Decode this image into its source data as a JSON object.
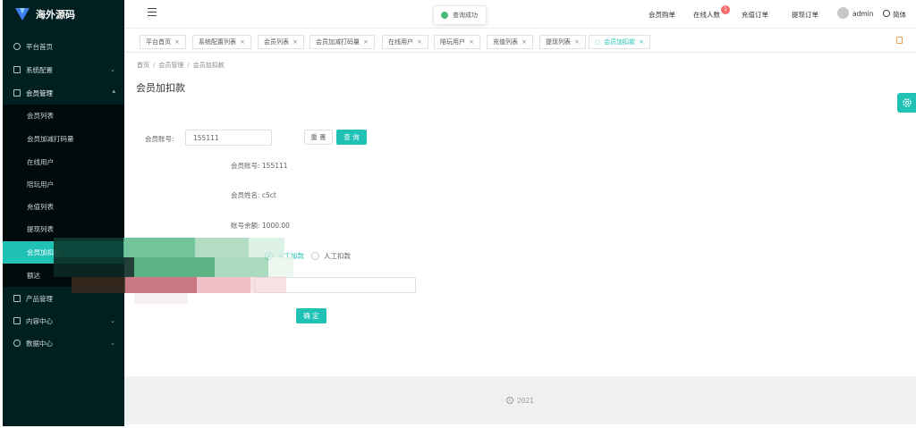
{
  "app": {
    "logo_text": "海外源码"
  },
  "sidebar": {
    "items": [
      {
        "label": "平台首页",
        "icon": "clock-icon"
      },
      {
        "label": "系统配置",
        "icon": "edit-icon"
      },
      {
        "label": "会员管理",
        "icon": "grid-icon"
      },
      {
        "label": "产品管理",
        "icon": "apps-icon"
      },
      {
        "label": "内容中心",
        "icon": "doc-icon"
      },
      {
        "label": "数据中心",
        "icon": "check-circle-icon"
      }
    ],
    "sub_items": [
      {
        "label": "会员列表"
      },
      {
        "label": "会员加减打码量"
      },
      {
        "label": "在线用户"
      },
      {
        "label": "陪玩用户"
      },
      {
        "label": "充值列表"
      },
      {
        "label": "提现列表"
      },
      {
        "label": "会员加扣款"
      },
      {
        "label": "额达"
      }
    ]
  },
  "header": {
    "nav": [
      "会员购单",
      "在线人数",
      "充值订单",
      "提现订单"
    ],
    "badge": "1",
    "user": "admin",
    "lang": "简体"
  },
  "toast": {
    "text": "查询成功"
  },
  "tabs": [
    {
      "label": "平台首页"
    },
    {
      "label": "系统配置列表"
    },
    {
      "label": "会员列表"
    },
    {
      "label": "会员加减打码量"
    },
    {
      "label": "在线用户"
    },
    {
      "label": "陪玩用户"
    },
    {
      "label": "充值列表"
    },
    {
      "label": "提现列表"
    },
    {
      "label": "会员加扣款"
    }
  ],
  "breadcrumb": [
    "首页",
    "会员管理",
    "会员加扣款"
  ],
  "page": {
    "title": "会员加扣款",
    "account_label": "会员账号:",
    "account_value": "155111",
    "reset_label": "重 置",
    "query_label": "查 询",
    "info": {
      "account": "会员账号: 155111",
      "name": "会员姓名: c5ct",
      "balance": "账号余额: 1000.00"
    },
    "radio_add": "人工加款",
    "radio_deduct": "人工扣款",
    "confirm_label": "确 定"
  },
  "footer": {
    "year": "2021"
  },
  "colors": {
    "accent": "#21c2b6",
    "sidebar": "#001f21",
    "badge": "#f56c6c"
  }
}
